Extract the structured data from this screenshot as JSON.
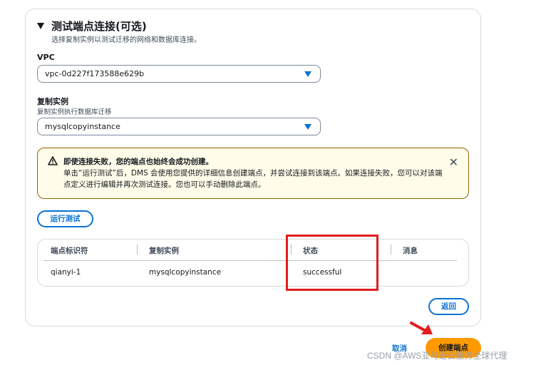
{
  "section": {
    "title": "测试端点连接(可选)",
    "description": "选择复制实例以测试迁移的网络和数据库连接。"
  },
  "vpc": {
    "label": "VPC",
    "value": "vpc-0d227f173588e629b"
  },
  "replication_instance": {
    "label": "复制实例",
    "description": "复制实例执行数据库迁移",
    "value": "mysqlcopyinstance"
  },
  "alert": {
    "title": "即使连接失败，您的端点也始终会成功创建。",
    "body": "单击“运行测试”后，DMS 会使用您提供的详细信息创建端点，并尝试连接到该端点。如果连接失败，您可以对该端点定义进行编辑并再次测试连接。您也可以手动删除此端点。",
    "close_icon": "close-icon",
    "status_color": "#8d6605"
  },
  "run_test_label": "运行测试",
  "table": {
    "columns": [
      "端点标识符",
      "复制实例",
      "状态",
      "消息"
    ],
    "rows": [
      {
        "endpoint": "qianyi-1",
        "instance": "mysqlcopyinstance",
        "status": "successful",
        "message": ""
      }
    ]
  },
  "back_label": "返回",
  "footer": {
    "cancel_label": "取消",
    "create_label": "创建端点"
  },
  "watermark": "CSDN @AWS亚马逊云服务全球代理",
  "colors": {
    "accent": "#0972d3",
    "primary": "#ff9900",
    "highlight": "#e31d1d"
  }
}
